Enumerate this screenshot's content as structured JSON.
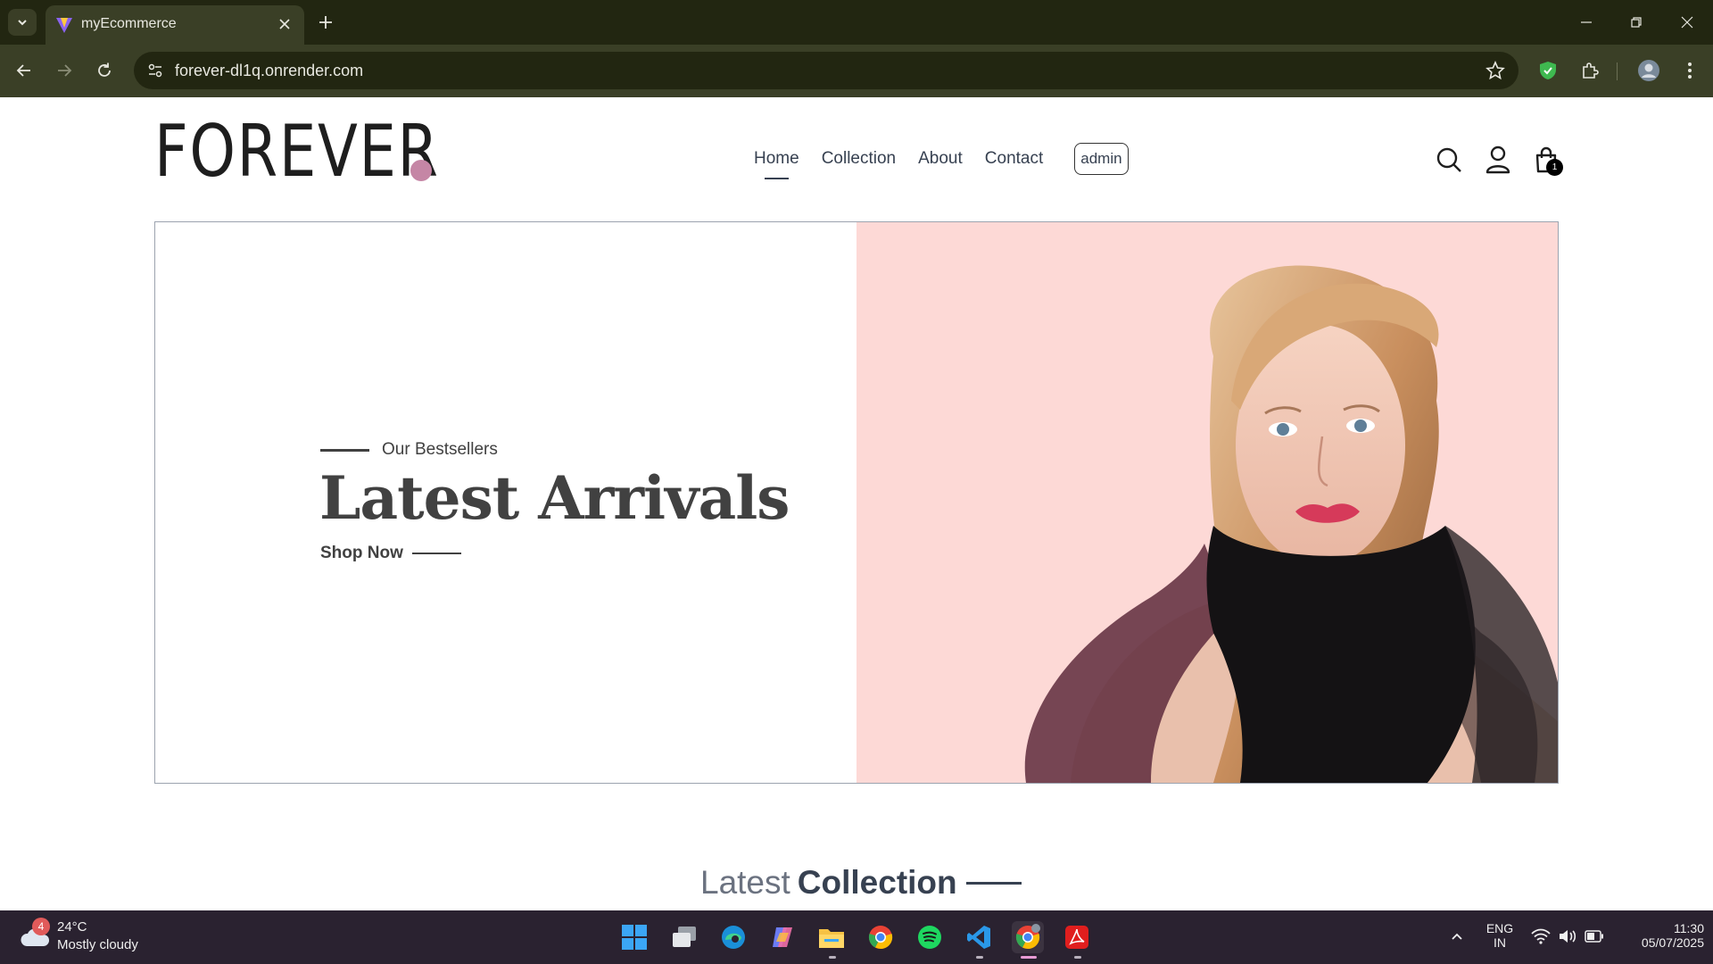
{
  "browser": {
    "tab_title": "myEcommerce",
    "url": "forever-dl1q.onrender.com"
  },
  "header": {
    "logo": "FOREVER",
    "nav": [
      {
        "label": "Home",
        "active": true
      },
      {
        "label": "Collection",
        "active": false
      },
      {
        "label": "About",
        "active": false
      },
      {
        "label": "Contact",
        "active": false
      }
    ],
    "admin_label": "admin",
    "cart_count": "1",
    "accent_color": "#c586a5"
  },
  "hero": {
    "eyebrow": "Our Bestsellers",
    "title": "Latest Arrivals",
    "cta": "Shop Now",
    "image_bg": "#fdd9d6"
  },
  "latest": {
    "part1": "Latest",
    "part2": "Collection"
  },
  "taskbar": {
    "weather_badge": "4",
    "temperature": "24°C",
    "weather": "Mostly cloudy",
    "lang_1": "ENG",
    "lang_2": "IN",
    "time": "11:30",
    "date": "05/07/2025",
    "apps": [
      "start-icon",
      "task-view-icon",
      "edge-icon",
      "copilot-icon",
      "file-explorer-icon",
      "chrome-icon",
      "spotify-icon",
      "vscode-icon",
      "chrome-profile-icon",
      "acrobat-icon"
    ]
  }
}
